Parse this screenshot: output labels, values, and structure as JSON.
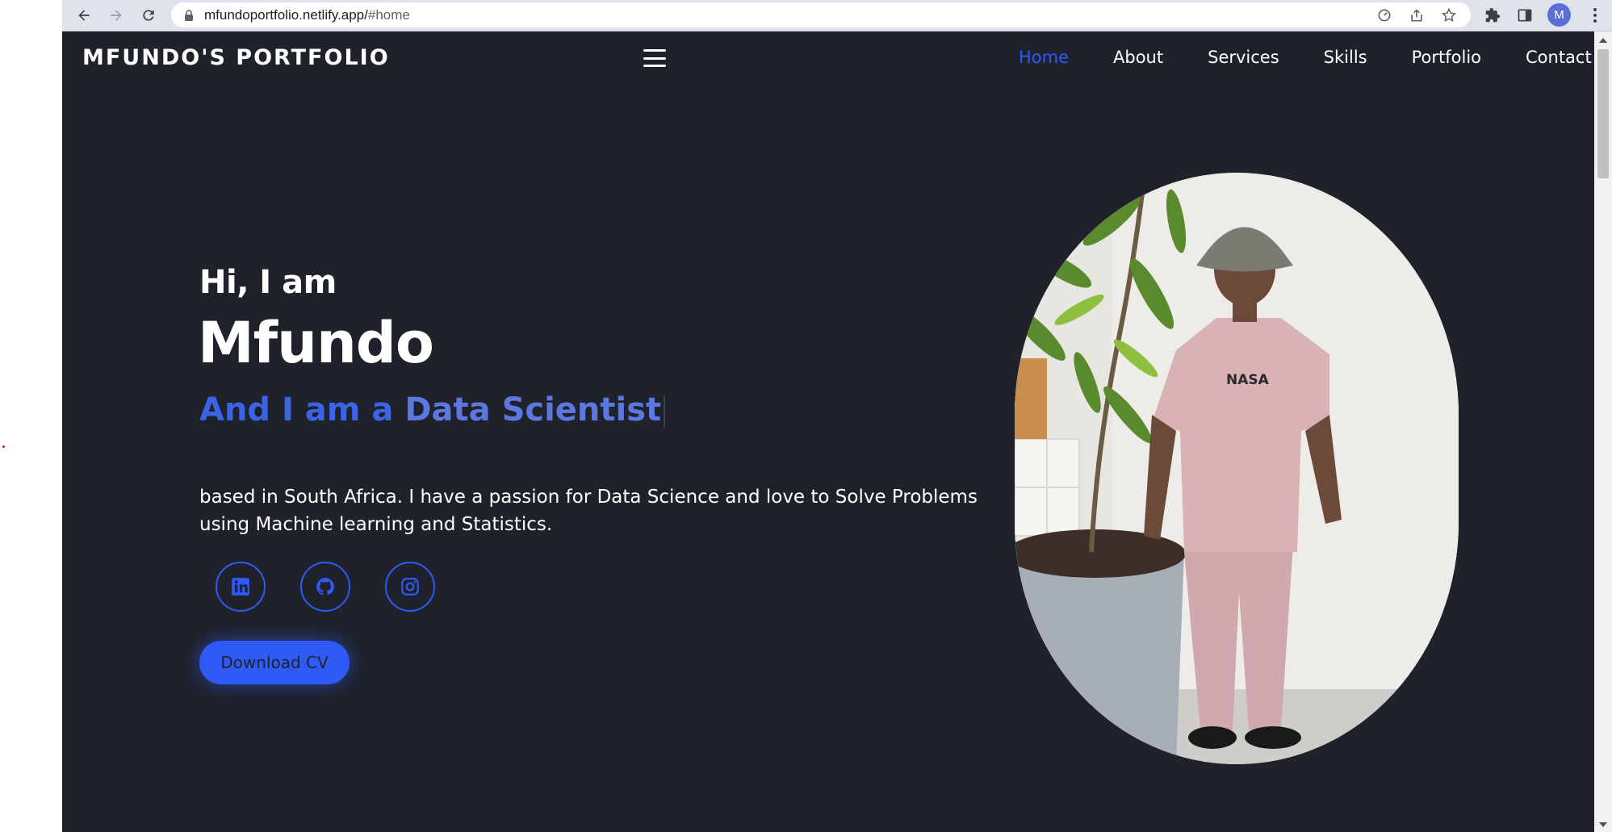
{
  "browser": {
    "url_host": "mfundoportfolio.netlify.app/",
    "url_path": "#home",
    "profile_initial": "M"
  },
  "navbar": {
    "brand": "MFUNDO'S PORTFOLIO",
    "links": [
      {
        "label": "Home",
        "active": true
      },
      {
        "label": "About",
        "active": false
      },
      {
        "label": "Services",
        "active": false
      },
      {
        "label": "Skills",
        "active": false
      },
      {
        "label": "Portfolio",
        "active": false
      },
      {
        "label": "Contact",
        "active": false
      }
    ]
  },
  "hero": {
    "greeting": "Hi, I am",
    "name": "Mfundo",
    "role_prefix": "And I am a ",
    "role_highlight": "Data Scientist",
    "description": "based in South Africa. I have a passion for Data Science and love to Solve Problems using Machine learning and Statistics.",
    "socials": [
      "linkedin-icon",
      "github-icon",
      "instagram-icon"
    ],
    "cta_label": "Download CV"
  },
  "colors": {
    "page_background": "#1f222b",
    "accent": "#2f5af5",
    "text": "#ffffff"
  }
}
